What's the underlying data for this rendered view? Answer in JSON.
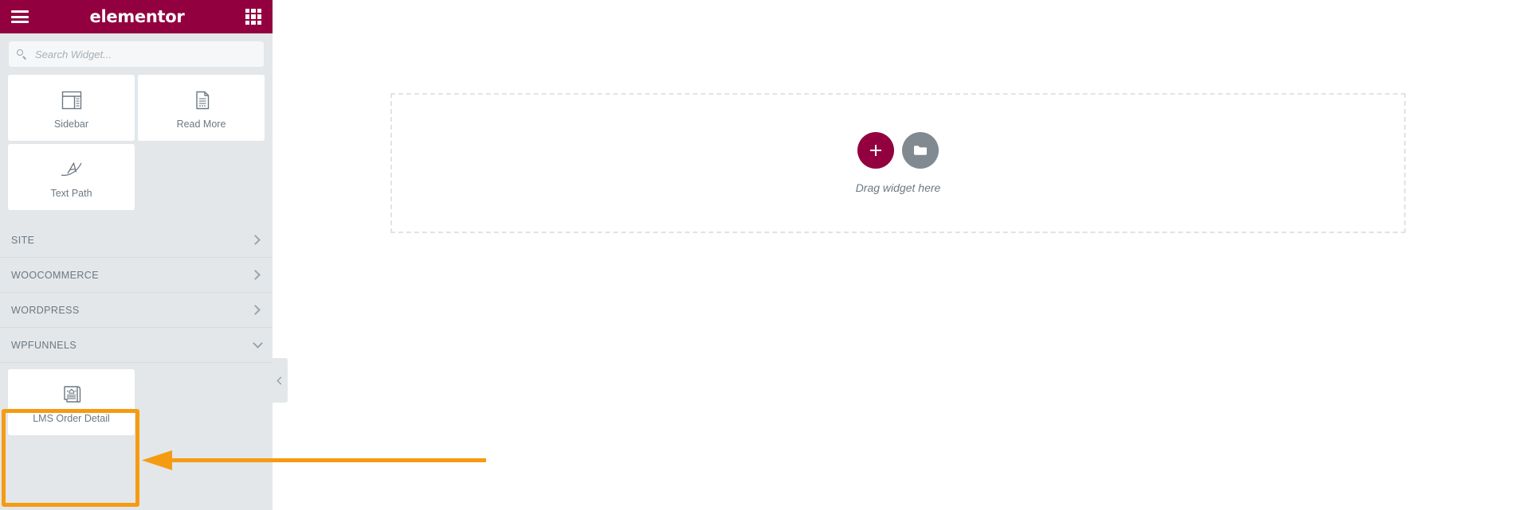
{
  "panel": {
    "header": {
      "menu_icon": "hamburger-icon",
      "brand": "elementor",
      "apps_icon": "grid-icon"
    },
    "search": {
      "icon": "search-icon",
      "placeholder": "Search Widget...",
      "value": ""
    },
    "widgets": [
      {
        "label": "Sidebar",
        "icon": "sidebar-widget-icon"
      },
      {
        "label": "Read More",
        "icon": "read-more-widget-icon"
      },
      {
        "label": "Text Path",
        "icon": "text-path-widget-icon"
      }
    ],
    "categories": [
      {
        "label": "SITE",
        "state": "collapsed",
        "icon": "chevron-right-icon"
      },
      {
        "label": "WOOCOMMERCE",
        "state": "collapsed",
        "icon": "chevron-right-icon"
      },
      {
        "label": "WORDPRESS",
        "state": "collapsed",
        "icon": "chevron-right-icon"
      },
      {
        "label": "WPFUNNELS",
        "state": "expanded",
        "icon": "chevron-down-icon"
      }
    ],
    "wpfunnels_widgets": [
      {
        "label": "LMS Order Detail",
        "icon": "lms-order-detail-icon",
        "highlighted": true
      }
    ],
    "collapse_handle": {
      "icon": "chevron-left-icon"
    }
  },
  "canvas": {
    "dropzone": {
      "add_section_label": "+",
      "add_section_icon": "plus-icon",
      "template_icon": "folder-icon",
      "hint": "Drag widget here"
    }
  },
  "annotation": {
    "arrow": "left-pointing-arrow",
    "highlight": "rectangle-highlight"
  },
  "colors": {
    "brand_magenta": "#93003f",
    "panel_background": "#e3e7e9",
    "card_background": "#ffffff",
    "text_muted": "#6d7882",
    "annotation_orange": "#f59b12",
    "template_gray": "#818a91",
    "dropzone_border": "#dfe3e8"
  }
}
